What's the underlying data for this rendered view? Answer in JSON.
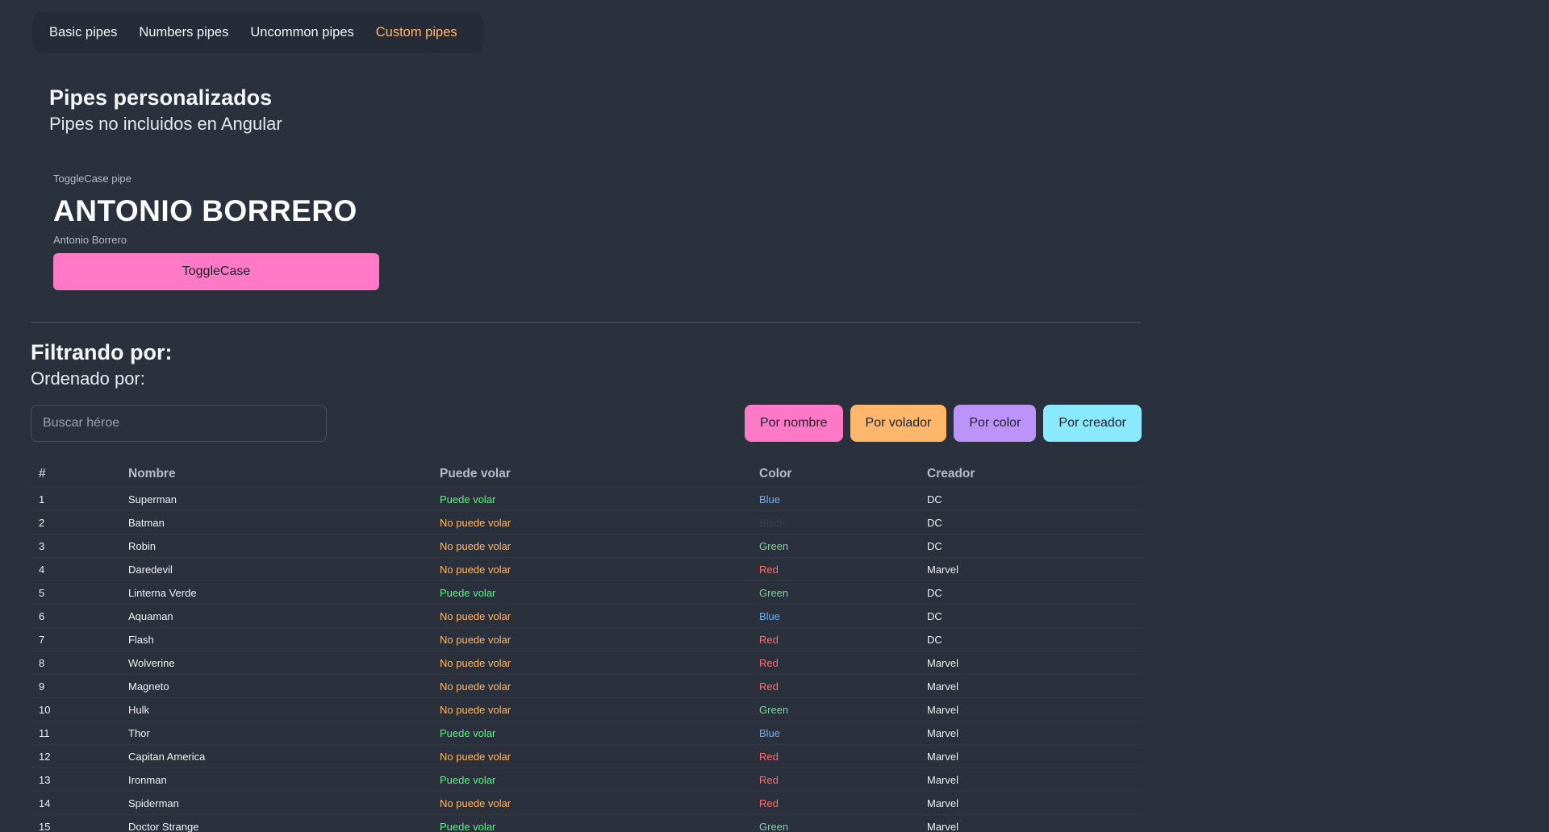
{
  "nav": {
    "items": [
      {
        "label": "Basic pipes",
        "active": false
      },
      {
        "label": "Numbers pipes",
        "active": false
      },
      {
        "label": "Uncommon pipes",
        "active": false
      },
      {
        "label": "Custom pipes",
        "active": true
      }
    ]
  },
  "header": {
    "title": "Pipes personalizados",
    "subtitle": "Pipes no incluidos en Angular"
  },
  "toggle_card": {
    "label": "ToggleCase pipe",
    "transformed": "ANTONIO BORRERO",
    "original": "Antonio Borrero",
    "button_label": "ToggleCase"
  },
  "filter": {
    "title": "Filtrando por:",
    "order": "Ordenado por:",
    "search_placeholder": "Buscar héroe"
  },
  "sort_buttons": [
    {
      "label": "Por nombre",
      "color": "#ff79c6"
    },
    {
      "label": "Por volador",
      "color": "#ffb86b"
    },
    {
      "label": "Por color",
      "color": "#bd93f9"
    },
    {
      "label": "Por creador",
      "color": "#8be9fd"
    }
  ],
  "colors": {
    "can_fly": "#50fa7b",
    "cannot_fly": "#ffb86b",
    "Blue": "#6fb0f0",
    "Black": "#3a3f4a",
    "Green": "#7fd4a0",
    "Red": "#ff6e6e"
  },
  "table": {
    "headers": [
      "#",
      "Nombre",
      "Puede volar",
      "Color",
      "Creador"
    ],
    "rows": [
      {
        "num": "1",
        "name": "Superman",
        "fly": "Puede volar",
        "can_fly": true,
        "color": "Blue",
        "creator": "DC"
      },
      {
        "num": "2",
        "name": "Batman",
        "fly": "No puede volar",
        "can_fly": false,
        "color": "Black",
        "creator": "DC"
      },
      {
        "num": "3",
        "name": "Robin",
        "fly": "No puede volar",
        "can_fly": false,
        "color": "Green",
        "creator": "DC"
      },
      {
        "num": "4",
        "name": "Daredevil",
        "fly": "No puede volar",
        "can_fly": false,
        "color": "Red",
        "creator": "Marvel"
      },
      {
        "num": "5",
        "name": "Linterna Verde",
        "fly": "Puede volar",
        "can_fly": true,
        "color": "Green",
        "creator": "DC"
      },
      {
        "num": "6",
        "name": "Aquaman",
        "fly": "No puede volar",
        "can_fly": false,
        "color": "Blue",
        "creator": "DC"
      },
      {
        "num": "7",
        "name": "Flash",
        "fly": "No puede volar",
        "can_fly": false,
        "color": "Red",
        "creator": "DC"
      },
      {
        "num": "8",
        "name": "Wolverine",
        "fly": "No puede volar",
        "can_fly": false,
        "color": "Red",
        "creator": "Marvel"
      },
      {
        "num": "9",
        "name": "Magneto",
        "fly": "No puede volar",
        "can_fly": false,
        "color": "Red",
        "creator": "Marvel"
      },
      {
        "num": "10",
        "name": "Hulk",
        "fly": "No puede volar",
        "can_fly": false,
        "color": "Green",
        "creator": "Marvel"
      },
      {
        "num": "11",
        "name": "Thor",
        "fly": "Puede volar",
        "can_fly": true,
        "color": "Blue",
        "creator": "Marvel"
      },
      {
        "num": "12",
        "name": "Capitan America",
        "fly": "No puede volar",
        "can_fly": false,
        "color": "Red",
        "creator": "Marvel"
      },
      {
        "num": "13",
        "name": "Ironman",
        "fly": "Puede volar",
        "can_fly": true,
        "color": "Red",
        "creator": "Marvel"
      },
      {
        "num": "14",
        "name": "Spiderman",
        "fly": "No puede volar",
        "can_fly": false,
        "color": "Red",
        "creator": "Marvel"
      },
      {
        "num": "15",
        "name": "Doctor Strange",
        "fly": "Puede volar",
        "can_fly": true,
        "color": "Green",
        "creator": "Marvel"
      }
    ]
  }
}
